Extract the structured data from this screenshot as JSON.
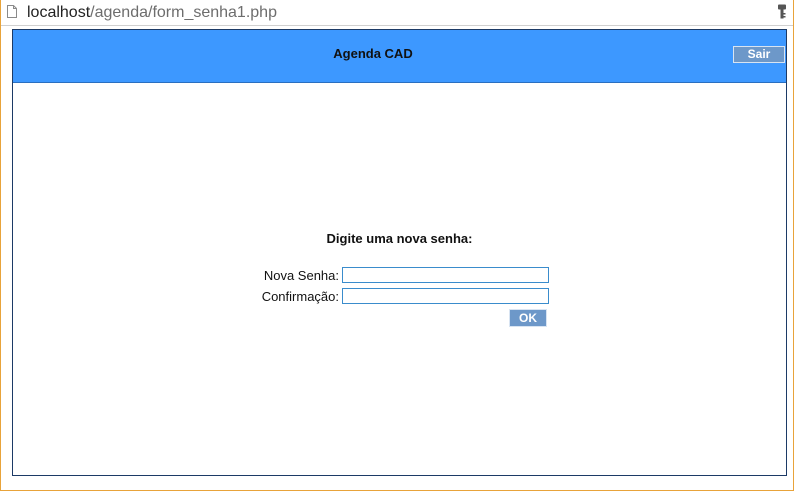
{
  "browser": {
    "url_host": "localhost",
    "url_path": "/agenda/form_senha1.php"
  },
  "header": {
    "title": "Agenda CAD",
    "logout_label": "Sair"
  },
  "form": {
    "heading": "Digite uma nova senha:",
    "new_password_label": "Nova Senha:",
    "new_password_value": "",
    "confirm_label": "Confirmação:",
    "confirm_value": "",
    "submit_label": "OK"
  },
  "colors": {
    "header_bg": "#3d98ff",
    "button_bg": "#6d98c9",
    "frame_border": "#1c3a66",
    "input_border": "#3a8ccc"
  },
  "icons": {
    "page": "page-icon",
    "key": "key-icon"
  }
}
